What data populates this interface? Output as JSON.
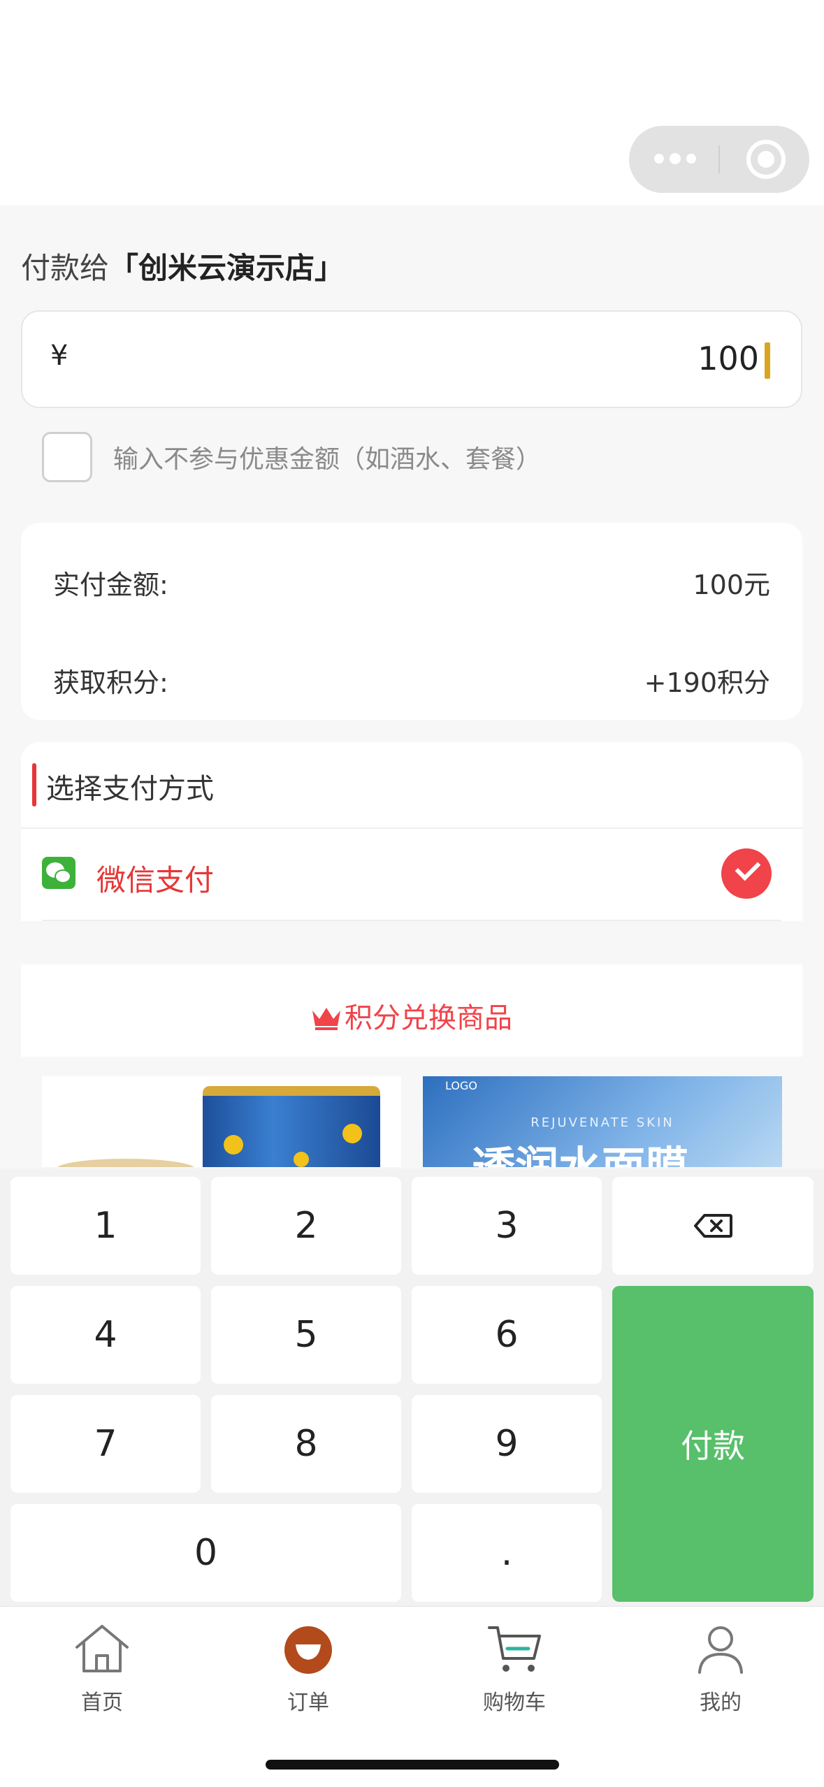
{
  "header": {
    "pay_to_prefix": "付款给",
    "shop_name": "「创米云演示店」"
  },
  "amount": {
    "currency": "¥",
    "value": "100"
  },
  "discount": {
    "label": "输入不参与优惠金额（如酒水、套餐）",
    "checked": false
  },
  "summary": {
    "actual_label": "实付金额:",
    "actual_value": "100元",
    "points_label": "获取积分:",
    "points_value": "+190积分"
  },
  "payment": {
    "title": "选择支付方式",
    "method_label": "微信支付",
    "selected": true
  },
  "exchange": {
    "title": "积分兑换商品"
  },
  "products": {
    "p2_logo": "LOGO",
    "p2_sub": "REJUVENATE SKIN",
    "p2_title": "透润水面膜"
  },
  "keypad": {
    "k1": "1",
    "k2": "2",
    "k3": "3",
    "k4": "4",
    "k5": "5",
    "k6": "6",
    "k7": "7",
    "k8": "8",
    "k9": "9",
    "k0": "0",
    "dot": ".",
    "pay": "付款"
  },
  "tabbar": {
    "home": "首页",
    "orders": "订单",
    "cart": "购物车",
    "mine": "我的"
  },
  "colors": {
    "accent_red": "#f0434a",
    "pay_green": "#58bf6b",
    "wechat_green": "#3db13a",
    "caret": "#d9a520",
    "active_tab": "#b34a1c"
  }
}
